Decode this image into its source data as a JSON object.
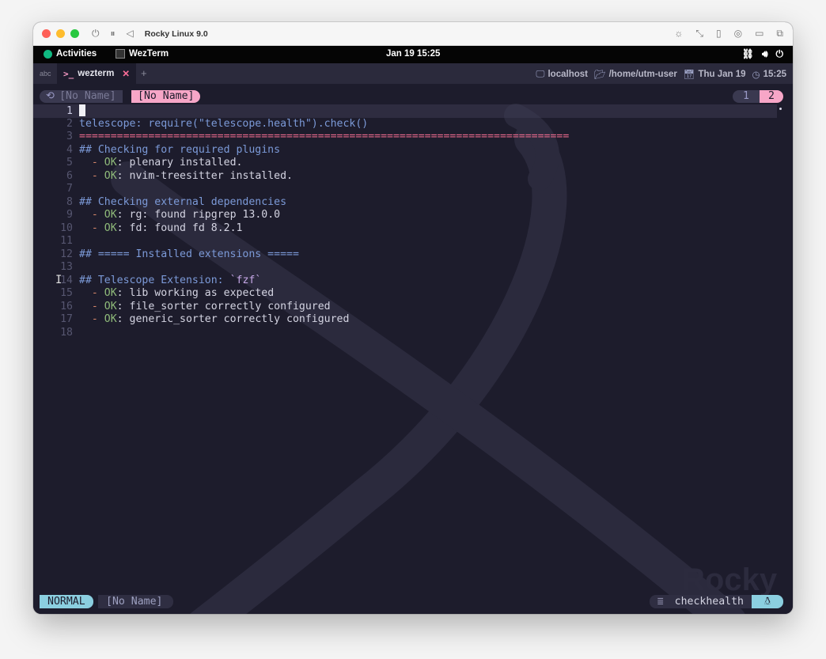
{
  "mac": {
    "title": "Rocky Linux 9.0",
    "traffic_colors": [
      "#fe5f57",
      "#febc2e",
      "#28c840"
    ]
  },
  "gnome": {
    "activities": "Activities",
    "app": "WezTerm",
    "clock": "Jan 19  15:25"
  },
  "tabbar": {
    "abc": "abc",
    "tab_label": "wezterm",
    "prompt_glyph": ">_",
    "close_glyph": "✕",
    "plus": "+",
    "host": "localhost",
    "path": "/home/utm-user",
    "date": "Thu Jan 19",
    "time": "15:25"
  },
  "bufferline": {
    "inactive": "[No Name]",
    "active": "[No Name]",
    "tab1": "1",
    "tab2": "2"
  },
  "lines": [
    {
      "n": "1",
      "parts": [],
      "cursor": true
    },
    {
      "n": "2",
      "parts": [
        {
          "c": "c-blue",
          "t": "telescope: require(\"telescope.health\").check()"
        }
      ]
    },
    {
      "n": "3",
      "parts": [
        {
          "c": "c-red",
          "t": "=============================================================================="
        }
      ]
    },
    {
      "n": "4",
      "parts": [
        {
          "c": "c-head",
          "t": "## Checking for required plugins"
        }
      ]
    },
    {
      "n": "5",
      "parts": [
        {
          "c": "c-dash",
          "t": "  - "
        },
        {
          "c": "c-ok",
          "t": "OK"
        },
        {
          "c": "c-text",
          "t": ": plenary installed."
        }
      ]
    },
    {
      "n": "6",
      "parts": [
        {
          "c": "c-dash",
          "t": "  - "
        },
        {
          "c": "c-ok",
          "t": "OK"
        },
        {
          "c": "c-text",
          "t": ": nvim-treesitter installed."
        }
      ]
    },
    {
      "n": "7",
      "parts": []
    },
    {
      "n": "8",
      "parts": [
        {
          "c": "c-head",
          "t": "## Checking external dependencies"
        }
      ]
    },
    {
      "n": "9",
      "parts": [
        {
          "c": "c-dash",
          "t": "  - "
        },
        {
          "c": "c-ok",
          "t": "OK"
        },
        {
          "c": "c-text",
          "t": ": rg: found ripgrep 13.0.0"
        }
      ]
    },
    {
      "n": "10",
      "parts": [
        {
          "c": "c-dash",
          "t": "  - "
        },
        {
          "c": "c-ok",
          "t": "OK"
        },
        {
          "c": "c-text",
          "t": ": fd: found fd 8.2.1"
        }
      ]
    },
    {
      "n": "11",
      "parts": []
    },
    {
      "n": "12",
      "parts": [
        {
          "c": "c-head",
          "t": "## ===== Installed extensions ====="
        }
      ]
    },
    {
      "n": "13",
      "parts": []
    },
    {
      "n": "14",
      "parts": [
        {
          "c": "c-head",
          "t": "## Telescope Extension: "
        },
        {
          "c": "c-code",
          "t": "`fzf`"
        }
      ]
    },
    {
      "n": "15",
      "parts": [
        {
          "c": "c-dash",
          "t": "  - "
        },
        {
          "c": "c-ok",
          "t": "OK"
        },
        {
          "c": "c-text",
          "t": ": lib working as expected"
        }
      ]
    },
    {
      "n": "16",
      "parts": [
        {
          "c": "c-dash",
          "t": "  - "
        },
        {
          "c": "c-ok",
          "t": "OK"
        },
        {
          "c": "c-text",
          "t": ": file_sorter correctly configured"
        }
      ]
    },
    {
      "n": "17",
      "parts": [
        {
          "c": "c-dash",
          "t": "  - "
        },
        {
          "c": "c-ok",
          "t": "OK"
        },
        {
          "c": "c-text",
          "t": ": generic_sorter correctly configured"
        }
      ]
    },
    {
      "n": "18",
      "parts": []
    }
  ],
  "statusline": {
    "mode": "NORMAL",
    "filename": "[No Name]",
    "filetype": "checkhealth"
  },
  "wallpaper_text": "Rocky"
}
